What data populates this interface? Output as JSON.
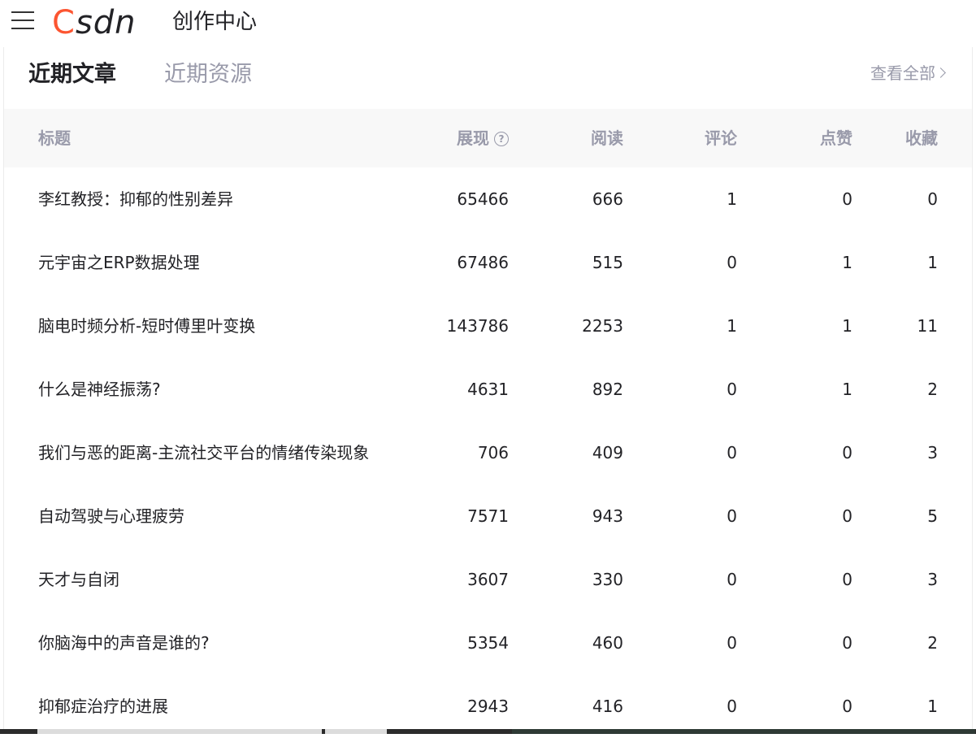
{
  "header": {
    "logo_c": "C",
    "logo_rest": "SDN",
    "title": "创作中心"
  },
  "tabs": {
    "active": "近期文章",
    "inactive": "近期资源"
  },
  "view_all": "查看全部",
  "columns": {
    "title": "标题",
    "impressions": "展现",
    "help_glyph": "?",
    "reads": "阅读",
    "comments": "评论",
    "likes": "点赞",
    "favorites": "收藏"
  },
  "rows": [
    {
      "title": "李红教授：抑郁的性别差异",
      "impressions": "65466",
      "reads": "666",
      "comments": "1",
      "likes": "0",
      "favorites": "0"
    },
    {
      "title": "元宇宙之ERP数据处理",
      "impressions": "67486",
      "reads": "515",
      "comments": "0",
      "likes": "1",
      "favorites": "1"
    },
    {
      "title": "脑电时频分析-短时傅里叶变换",
      "impressions": "143786",
      "reads": "2253",
      "comments": "1",
      "likes": "1",
      "favorites": "11"
    },
    {
      "title": "什么是神经振荡?",
      "impressions": "4631",
      "reads": "892",
      "comments": "0",
      "likes": "1",
      "favorites": "2"
    },
    {
      "title": "我们与恶的距离-主流社交平台的情绪传染现象",
      "impressions": "706",
      "reads": "409",
      "comments": "0",
      "likes": "0",
      "favorites": "3"
    },
    {
      "title": "自动驾驶与心理疲劳",
      "impressions": "7571",
      "reads": "943",
      "comments": "0",
      "likes": "0",
      "favorites": "5"
    },
    {
      "title": "天才与自闭",
      "impressions": "3607",
      "reads": "330",
      "comments": "0",
      "likes": "0",
      "favorites": "3"
    },
    {
      "title": "你脑海中的声音是谁的?",
      "impressions": "5354",
      "reads": "460",
      "comments": "0",
      "likes": "0",
      "favorites": "2"
    },
    {
      "title": "抑郁症治疗的进展",
      "impressions": "2943",
      "reads": "416",
      "comments": "0",
      "likes": "0",
      "favorites": "1"
    }
  ],
  "colors": {
    "brand": "#fc5531",
    "muted": "#999aaa",
    "text": "#222226",
    "header_bg": "#f8f8f8"
  }
}
